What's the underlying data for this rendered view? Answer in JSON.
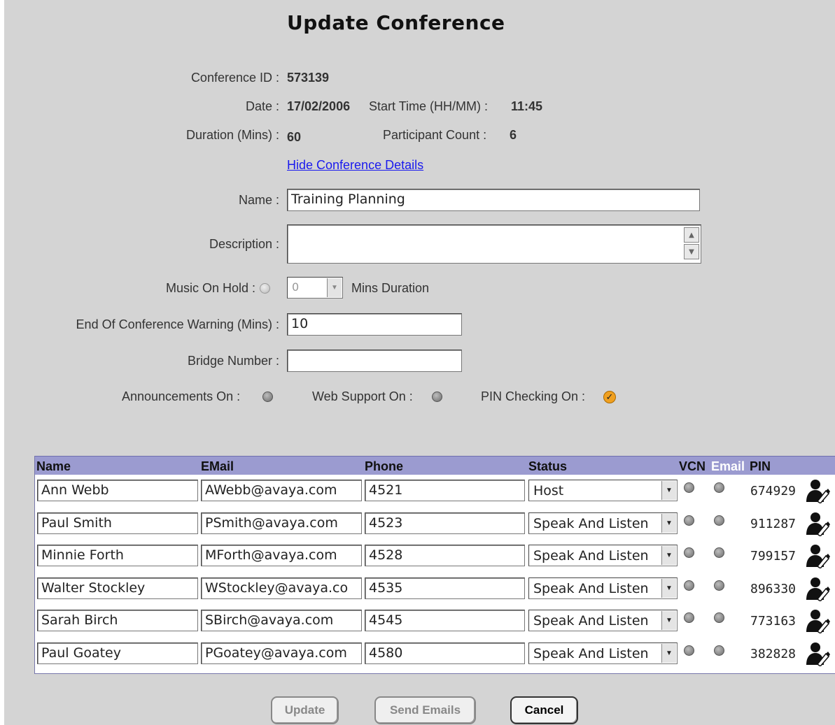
{
  "title": "Update Conference",
  "info": {
    "conference_id_label": "Conference ID :",
    "conference_id": "573139",
    "date_label": "Date :",
    "date": "17/02/2006",
    "start_time_label": "Start Time (HH/MM) :",
    "start_time": "11:45",
    "duration_label": "Duration (Mins) :",
    "duration": "60",
    "participant_count_label": "Participant Count :",
    "participant_count": "6",
    "hide_details_link": "Hide Conference Details"
  },
  "form": {
    "name_label": "Name :",
    "name_value": "Training Planning",
    "description_label": "Description :",
    "description_value": "",
    "music_on_hold_label": "Music On Hold :",
    "music_mins_value": "0",
    "mins_duration_label": "Mins Duration",
    "end_warning_label": "End Of Conference Warning (Mins) :",
    "end_warning_value": "10",
    "bridge_number_label": "Bridge Number :",
    "bridge_number_value": "",
    "announcements_label": "Announcements On :",
    "web_support_label": "Web Support On :",
    "pin_checking_label": "PIN Checking On :",
    "announcements_on": false,
    "web_support_on": false,
    "pin_checking_on": true
  },
  "table": {
    "headers": {
      "name": "Name",
      "email": "EMail",
      "phone": "Phone",
      "status": "Status",
      "vcn": "VCN",
      "email_flag": "Email",
      "pin": "PIN"
    },
    "rows": [
      {
        "name": "Ann Webb",
        "email": "AWebb@avaya.com",
        "phone": "4521",
        "status": "Host",
        "pin": "674929"
      },
      {
        "name": "Paul Smith",
        "email": "PSmith@avaya.com",
        "phone": "4523",
        "status": "Speak And Listen",
        "pin": "911287"
      },
      {
        "name": "Minnie Forth",
        "email": "MForth@avaya.com",
        "phone": "4528",
        "status": "Speak And Listen",
        "pin": "799157"
      },
      {
        "name": "Walter Stockley",
        "email": "WStockley@avaya.co",
        "phone": "4535",
        "status": "Speak And Listen",
        "pin": "896330"
      },
      {
        "name": "Sarah Birch",
        "email": "SBirch@avaya.com",
        "phone": "4545",
        "status": "Speak And Listen",
        "pin": "773163"
      },
      {
        "name": "Paul Goatey",
        "email": "PGoatey@avaya.com",
        "phone": "4580",
        "status": "Speak And Listen",
        "pin": "382828"
      }
    ]
  },
  "buttons": {
    "update": "Update",
    "send_emails": "Send Emails",
    "cancel": "Cancel"
  },
  "colors": {
    "background": "#d4d4d4",
    "table_header": "#9b9bd0",
    "link": "#1a1aee",
    "pin_check": "#f0a020"
  },
  "icons": {
    "participant_action": "user-edit-icon",
    "scroll_up": "arrow-up-icon",
    "scroll_down": "arrow-down-icon",
    "dropdown": "chevron-down-icon"
  }
}
